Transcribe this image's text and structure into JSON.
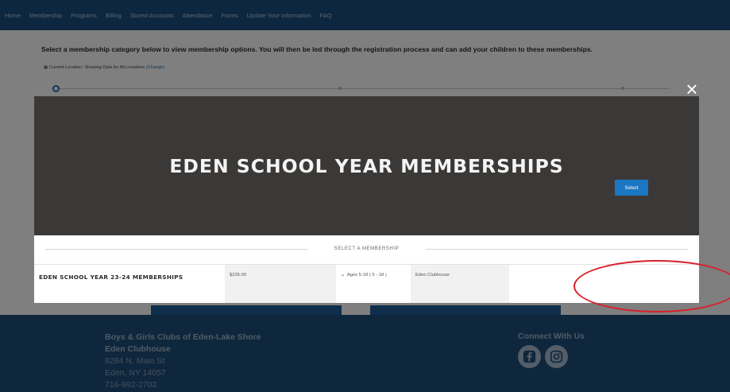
{
  "nav": {
    "items": [
      "Home",
      "Membership",
      "Programs",
      "Billing",
      "Stored Accounts",
      "Attendance",
      "Forms",
      "Update Your Information",
      "FAQ"
    ]
  },
  "page": {
    "intro": "Select a membership category below to view membership options. You will then be led through the registration process and can add your children to these memberships.",
    "location_text": "Current Location: Showing Data for All Locations",
    "location_change": "(Change)"
  },
  "modal": {
    "title": "EDEN SCHOOL YEAR MEMBERSHIPS",
    "select_label": "SELECT A MEMBERSHIP",
    "row": {
      "name": "EDEN SCHOOL YEAR 23-24 MEMBERSHIPS",
      "price": "$225.00",
      "ages": "Ages 5-18 ( 5 - 18 )",
      "location": "Eden Clubhouse",
      "action": "Select"
    },
    "close_glyph": "×"
  },
  "footer": {
    "org": "Boys & Girls Clubs of Eden-Lake Shore",
    "clubhouse": "Eden Clubhouse",
    "street": "8284 N. Main St",
    "city": "Eden, NY 14057",
    "phone": "716-992-2702",
    "connect": "Connect With Us"
  },
  "icons": [
    "calendar-icon",
    "close-icon",
    "chevron-down-icon",
    "facebook-icon",
    "instagram-icon"
  ],
  "colors": {
    "nav_bg": "#1d4f80",
    "footer_bg": "#1f4e79",
    "hero_bg": "#3b3937",
    "button": "#1c77c3",
    "annotation": "#d9202a"
  }
}
